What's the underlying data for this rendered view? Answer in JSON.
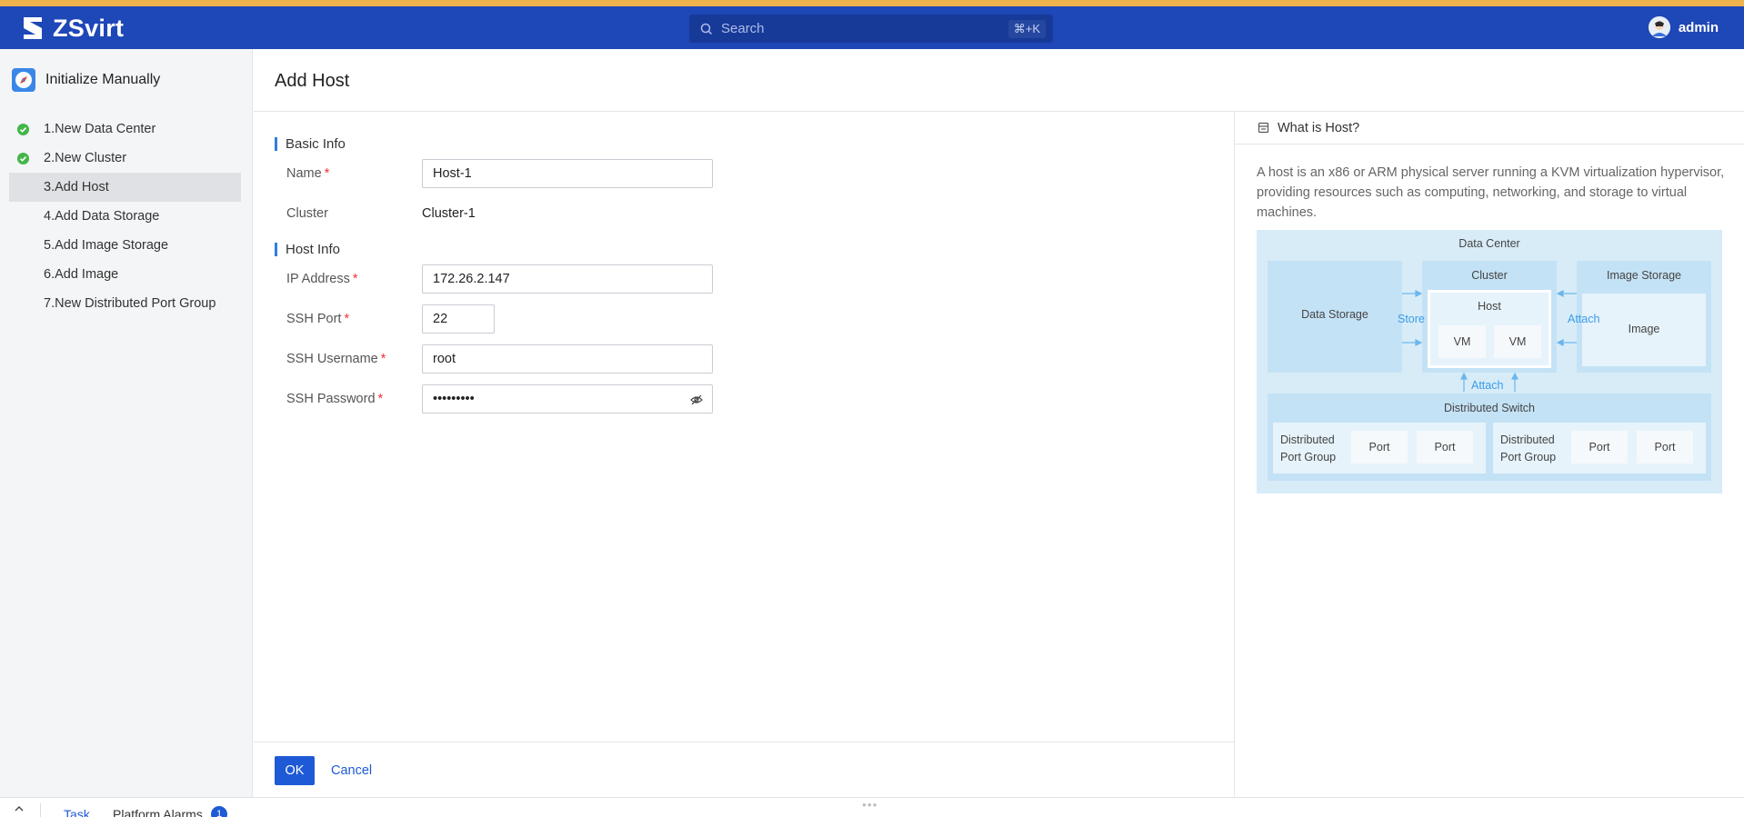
{
  "header": {
    "logo_text": "ZSvirt",
    "search_placeholder": "Search",
    "search_shortcut": "⌘+K",
    "username": "admin",
    "brand_color": "#1e47b7",
    "accent_stripe_color": "#f0b24a"
  },
  "sidebar": {
    "title": "Initialize Manually",
    "steps": [
      {
        "label": "1.New Data Center",
        "status": "done"
      },
      {
        "label": "2.New Cluster",
        "status": "done"
      },
      {
        "label": "3.Add Host",
        "status": "active"
      },
      {
        "label": "4.Add Data Storage",
        "status": "pending"
      },
      {
        "label": "5.Add Image Storage",
        "status": "pending"
      },
      {
        "label": "6.Add Image",
        "status": "pending"
      },
      {
        "label": "7.New Distributed Port Group",
        "status": "pending"
      }
    ]
  },
  "page": {
    "title": "Add Host"
  },
  "form": {
    "basic_info_title": "Basic Info",
    "name_label": "Name",
    "name_value": "Host-1",
    "cluster_label": "Cluster",
    "cluster_value": "Cluster-1",
    "host_info_title": "Host Info",
    "ip_label": "IP Address",
    "ip_value": "172.26.2.147",
    "ssh_port_label": "SSH Port",
    "ssh_port_value": "22",
    "ssh_user_label": "SSH Username",
    "ssh_user_value": "root",
    "ssh_password_label": "SSH Password",
    "ssh_password_value": "•••••••••",
    "required_mark": "*"
  },
  "actions": {
    "ok_label": "OK",
    "cancel_label": "Cancel"
  },
  "help": {
    "title": "What is Host?",
    "text": "A host is an x86 or ARM physical server running a KVM virtualization hypervisor, providing resources such as computing, networking, and storage to virtual machines.",
    "diagram": {
      "data_center": "Data Center",
      "data_storage": "Data Storage",
      "cluster": "Cluster",
      "host": "Host",
      "vm1": "VM",
      "vm2": "VM",
      "image_storage": "Image Storage",
      "image": "Image",
      "store": "Store",
      "attach_right": "Attach",
      "attach_bottom": "Attach",
      "distributed_switch": "Distributed Switch",
      "dpg1": "Distributed Port Group",
      "dpg2": "Distributed Port Group",
      "port1": "Port",
      "port2": "Port",
      "port3": "Port",
      "port4": "Port"
    }
  },
  "bottombar": {
    "task_tab": "Task",
    "alarms_tab": "Platform Alarms",
    "alarms_count": "1"
  }
}
